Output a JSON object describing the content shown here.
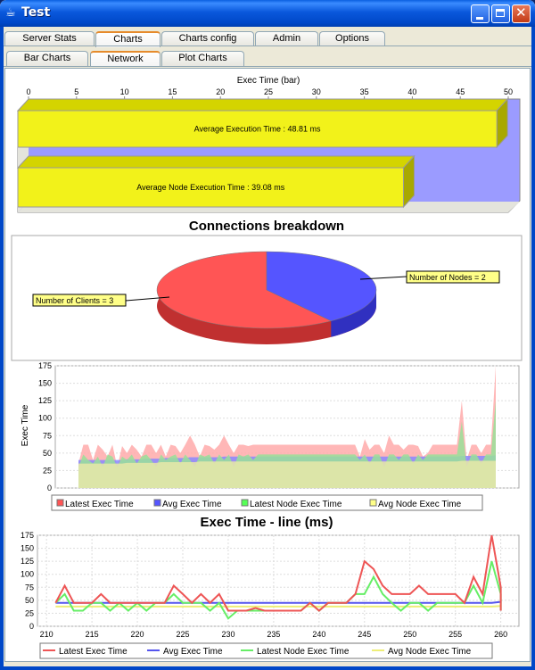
{
  "window": {
    "title": "Test"
  },
  "tabs_top": [
    {
      "label": "Server Stats"
    },
    {
      "label": "Charts"
    },
    {
      "label": "Charts config"
    },
    {
      "label": "Admin"
    },
    {
      "label": "Options"
    }
  ],
  "tabs_sub": [
    {
      "label": "Bar Charts"
    },
    {
      "label": "Network"
    },
    {
      "label": "Plot Charts"
    }
  ],
  "selected_top_tab": "Charts",
  "selected_sub_tab": "Network",
  "colors": {
    "titlebar": "#0058e6",
    "yellow_bar": "#f2f21a",
    "red": "#ff5555",
    "blue": "#5555ff",
    "green": "#55ff55",
    "pale_yellow": "#ffff88"
  },
  "chart_data": [
    {
      "type": "bar",
      "title": "",
      "xlabel": "Exec Time (bar)",
      "xlim": [
        0,
        50
      ],
      "ticks": [
        "0",
        "5",
        "10",
        "15",
        "20",
        "25",
        "30",
        "35",
        "40",
        "45",
        "50"
      ],
      "bars": [
        {
          "label": "Average Execution Time : 48.81 ms",
          "value": 48.81
        },
        {
          "label": "Average Node Execution Time : 39.08 ms",
          "value": 39.08
        }
      ]
    },
    {
      "type": "pie",
      "title": "Connections breakdown",
      "slices": [
        {
          "label": "Number of Clients = 3",
          "value": 3
        },
        {
          "label": "Number of Nodes = 2",
          "value": 2
        }
      ]
    },
    {
      "type": "area",
      "title": "",
      "ylabel": "Exec Time",
      "ylim": [
        0,
        175
      ],
      "yticks": [
        "0",
        "25",
        "50",
        "75",
        "100",
        "125",
        "150",
        "175"
      ],
      "legend": [
        "Latest Exec Time",
        "Avg Exec Time",
        "Latest Node Exec Time",
        "Avg Node Exec Time"
      ],
      "series": [
        {
          "name": "Latest Exec Time",
          "values": [
            35,
            62,
            62,
            40,
            62,
            55,
            45,
            62,
            30,
            60,
            50,
            62,
            55,
            45,
            62,
            62,
            50,
            62,
            45,
            62,
            60,
            50,
            62,
            75,
            62,
            45,
            62,
            60,
            55,
            62,
            75,
            62,
            50,
            62,
            62,
            60,
            62,
            62,
            62,
            62,
            62,
            62,
            62,
            62,
            62,
            62,
            62,
            62,
            62,
            62,
            62,
            62,
            62,
            62,
            62,
            62,
            62,
            62,
            45,
            70,
            55,
            62,
            62,
            50,
            75,
            62,
            62,
            55,
            62,
            62,
            60,
            45,
            50,
            62,
            62,
            62,
            62,
            62,
            62,
            125,
            40,
            62,
            62,
            50,
            62,
            62,
            175
          ]
        },
        {
          "name": "Avg Exec Time",
          "values": [
            40,
            40,
            40,
            40,
            40,
            40,
            40,
            40,
            40,
            40,
            41,
            41,
            41,
            41,
            42,
            42,
            42,
            42,
            43,
            43,
            43,
            43,
            43,
            44,
            44,
            44,
            44,
            44,
            44,
            44,
            45,
            45,
            45,
            45,
            45,
            45,
            45,
            45,
            45,
            45,
            45,
            45,
            45,
            45,
            45,
            45,
            45,
            45,
            45,
            45,
            45,
            45,
            45,
            45,
            45,
            45,
            45,
            45,
            45,
            45,
            45,
            45,
            45,
            45,
            45,
            45,
            45,
            45,
            45,
            45,
            45,
            45,
            45,
            45,
            45,
            45,
            45,
            45,
            45,
            46,
            46,
            46,
            46,
            46,
            46,
            46,
            47
          ]
        },
        {
          "name": "Latest Node Exec Time",
          "values": [
            30,
            48,
            40,
            35,
            45,
            30,
            48,
            45,
            30,
            45,
            40,
            48,
            35,
            45,
            48,
            40,
            30,
            48,
            40,
            45,
            48,
            35,
            48,
            40,
            30,
            48,
            45,
            48,
            35,
            48,
            40,
            48,
            30,
            48,
            45,
            48,
            40,
            48,
            48,
            48,
            48,
            48,
            48,
            48,
            48,
            48,
            48,
            48,
            48,
            48,
            48,
            48,
            48,
            48,
            48,
            48,
            48,
            48,
            40,
            48,
            35,
            48,
            48,
            30,
            48,
            48,
            40,
            48,
            48,
            35,
            48,
            40,
            48,
            48,
            48,
            48,
            48,
            48,
            48,
            95,
            30,
            48,
            48,
            35,
            48,
            48,
            125
          ]
        },
        {
          "name": "Avg Node Exec Time",
          "values": [
            35,
            35,
            35,
            35,
            35,
            35,
            35,
            35,
            35,
            35,
            36,
            36,
            36,
            36,
            36,
            36,
            36,
            37,
            37,
            37,
            37,
            37,
            37,
            37,
            37,
            38,
            38,
            38,
            38,
            38,
            38,
            38,
            38,
            38,
            38,
            38,
            38,
            38,
            38,
            38,
            38,
            38,
            38,
            38,
            38,
            38,
            38,
            38,
            38,
            38,
            38,
            38,
            38,
            38,
            38,
            38,
            38,
            38,
            38,
            38,
            38,
            38,
            38,
            38,
            38,
            38,
            38,
            38,
            38,
            38,
            38,
            38,
            38,
            38,
            38,
            38,
            38,
            38,
            38,
            39,
            39,
            39,
            39,
            39,
            39,
            39,
            39
          ]
        }
      ]
    },
    {
      "type": "line",
      "title": "Exec Time - line (ms)",
      "xlim": [
        209,
        262
      ],
      "ylim": [
        0,
        175
      ],
      "xticks": [
        "210",
        "215",
        "220",
        "225",
        "230",
        "235",
        "240",
        "245",
        "250",
        "255",
        "260"
      ],
      "yticks": [
        "0",
        "25",
        "50",
        "75",
        "100",
        "125",
        "150",
        "175"
      ],
      "legend": [
        "Latest Exec Time",
        "Avg Exec Time",
        "Latest Node Exec Time",
        "Avg Node Exec Time"
      ],
      "x": [
        211,
        212,
        213,
        214,
        215,
        216,
        217,
        218,
        219,
        220,
        221,
        222,
        223,
        224,
        225,
        226,
        227,
        228,
        229,
        230,
        231,
        232,
        233,
        234,
        235,
        236,
        237,
        238,
        239,
        240,
        241,
        242,
        243,
        244,
        245,
        246,
        247,
        248,
        249,
        250,
        251,
        252,
        253,
        254,
        255,
        256,
        257,
        258,
        259,
        260
      ],
      "series": [
        {
          "name": "Latest Exec Time",
          "values": [
            45,
            78,
            45,
            45,
            45,
            62,
            45,
            45,
            45,
            45,
            45,
            45,
            45,
            78,
            62,
            45,
            62,
            45,
            62,
            30,
            30,
            30,
            35,
            30,
            30,
            30,
            30,
            30,
            45,
            30,
            45,
            45,
            45,
            62,
            125,
            110,
            78,
            62,
            62,
            62,
            78,
            62,
            62,
            62,
            62,
            45,
            95,
            62,
            175,
            75,
            30
          ]
        },
        {
          "name": "Avg Exec Time",
          "values": [
            45,
            45,
            45,
            45,
            45,
            45,
            45,
            45,
            45,
            45,
            45,
            45,
            45,
            45,
            45,
            45,
            45,
            45,
            45,
            45,
            45,
            45,
            45,
            45,
            45,
            45,
            45,
            45,
            45,
            45,
            45,
            45,
            45,
            45,
            45,
            45,
            45,
            45,
            45,
            45,
            45,
            45,
            45,
            45,
            45,
            45,
            45,
            45,
            45,
            47,
            47
          ]
        },
        {
          "name": "Latest Node Exec Time",
          "values": [
            45,
            62,
            30,
            30,
            45,
            45,
            30,
            45,
            30,
            45,
            30,
            45,
            45,
            62,
            45,
            45,
            45,
            30,
            45,
            15,
            30,
            30,
            30,
            30,
            30,
            30,
            30,
            30,
            45,
            30,
            45,
            45,
            45,
            62,
            62,
            95,
            62,
            45,
            30,
            45,
            45,
            30,
            45,
            45,
            45,
            45,
            78,
            45,
            125,
            62,
            30
          ]
        },
        {
          "name": "Avg Node Exec Time",
          "values": [
            38,
            38,
            38,
            38,
            38,
            38,
            38,
            38,
            38,
            38,
            38,
            38,
            38,
            38,
            38,
            38,
            38,
            38,
            38,
            38,
            38,
            38,
            38,
            38,
            38,
            38,
            38,
            38,
            38,
            38,
            38,
            38,
            38,
            38,
            38,
            38,
            38,
            38,
            38,
            38,
            38,
            38,
            38,
            38,
            38,
            38,
            38,
            38,
            38,
            39,
            39
          ]
        }
      ]
    }
  ]
}
